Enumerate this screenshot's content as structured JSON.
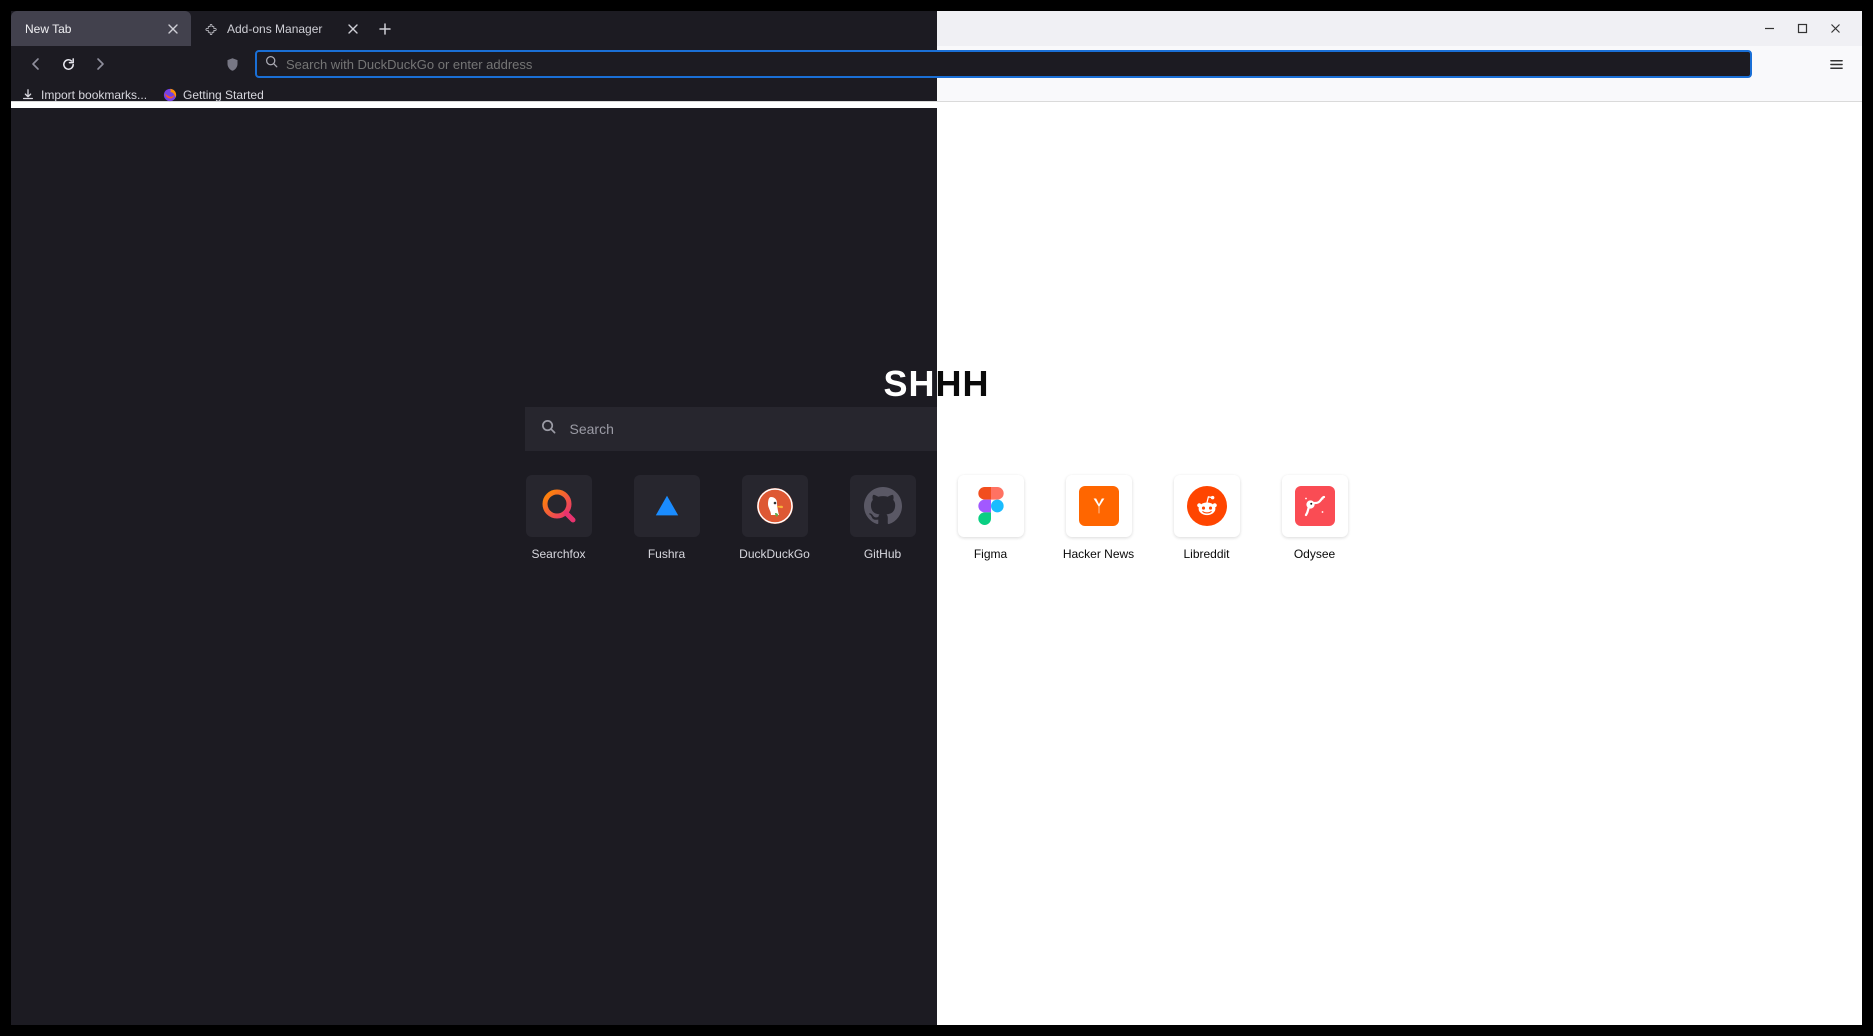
{
  "tabs": {
    "tab1": {
      "label": "New Tab"
    },
    "tab2": {
      "label": "Add-ons Manager"
    }
  },
  "urlbar": {
    "placeholder": "Search with DuckDuckGo or enter address"
  },
  "bookmarks": {
    "import": {
      "label": "Import bookmarks..."
    },
    "getting_started": {
      "label": "Getting Started"
    }
  },
  "logo": {
    "left": "SH",
    "right": "HH"
  },
  "big_search": {
    "placeholder": "Search"
  },
  "shortcuts": {
    "searchfox": {
      "label": "Searchfox"
    },
    "fushra": {
      "label": "Fushra"
    },
    "duckduckgo": {
      "label": "DuckDuckGo"
    },
    "github": {
      "label": "GitHub"
    },
    "figma": {
      "label": "Figma"
    },
    "hackernews": {
      "label": "Hacker News"
    },
    "libreddit": {
      "label": "Libreddit"
    },
    "odysee": {
      "label": "Odysee"
    }
  }
}
